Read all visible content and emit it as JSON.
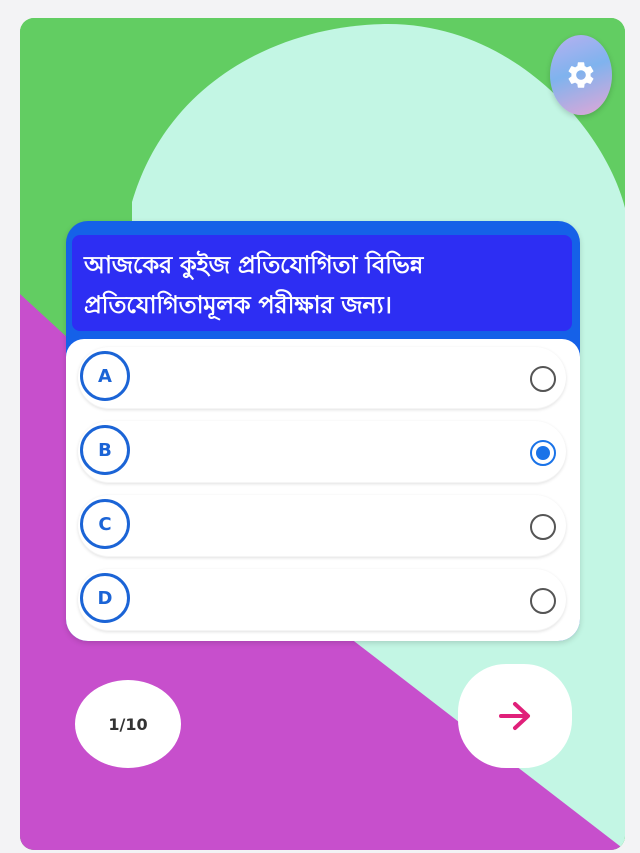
{
  "question": {
    "text": "আজকের কুইজ প্রতিযোগিতা বিভিন্ন প্রতিযোগিতামূলক পরীক্ষার জন্য।"
  },
  "options": [
    {
      "letter": "A",
      "selected": false
    },
    {
      "letter": "B",
      "selected": true
    },
    {
      "letter": "C",
      "selected": false
    },
    {
      "letter": "D",
      "selected": false
    }
  ],
  "progress": {
    "label": "1/10"
  },
  "icons": {
    "settings": "gear-icon",
    "next": "arrow-right-icon"
  },
  "colors": {
    "green": "#62cd62",
    "mint": "#c3f6e4",
    "magenta": "#c74fcc",
    "question_bg": "#2d2ef3",
    "accent_blue": "#1b64d6",
    "arrow_pink": "#e0207a"
  }
}
